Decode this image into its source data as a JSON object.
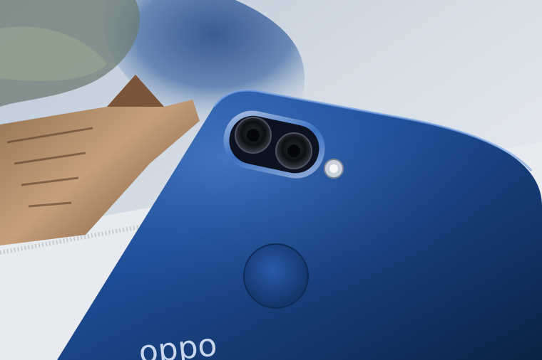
{
  "photo": {
    "phone_color": "#1f4f9a",
    "background_colors": [
      "#d7dbe2",
      "#8ea6c4",
      "#c39b6f",
      "#6b4a33"
    ],
    "logo_text": "oppo"
  }
}
